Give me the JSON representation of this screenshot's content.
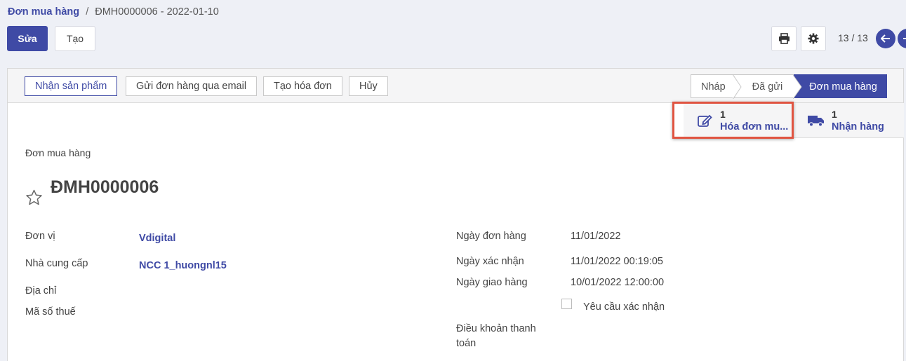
{
  "breadcrumb": {
    "parent": "Đơn mua hàng",
    "separator": "/",
    "current": "ĐMH0000006 - 2022-01-10"
  },
  "toolbar": {
    "edit_label": "Sửa",
    "create_label": "Tạo",
    "print_icon": "print-icon",
    "settings_icon": "gear-icon",
    "pager": "13 / 13"
  },
  "header_buttons": {
    "receive": "Nhận sản phẩm",
    "send_email": "Gửi đơn hàng qua email",
    "create_invoice": "Tạo hóa đơn",
    "cancel": "Hủy"
  },
  "stages": {
    "draft": "Nháp",
    "sent": "Đã gửi",
    "purchase_order": "Đơn mua hàng"
  },
  "smart_buttons": {
    "invoice": {
      "count": "1",
      "label": "Hóa đơn mu..."
    },
    "receipt": {
      "count": "1",
      "label": "Nhận hàng"
    }
  },
  "form": {
    "doc_type": "Đơn mua hàng",
    "name": "ĐMH0000006",
    "left": {
      "unit_label": "Đơn vị",
      "unit_value": "Vdigital",
      "vendor_label": "Nhà cung cấp",
      "vendor_value": "NCC 1_huongnl15",
      "address_label": "Địa chỉ",
      "tax_label": "Mã số thuế"
    },
    "right": {
      "order_date_label": "Ngày đơn hàng",
      "order_date_value": "11/01/2022",
      "confirm_date_label": "Ngày xác nhận",
      "confirm_date_value": "11/01/2022 00:19:05",
      "delivery_date_label": "Ngày giao hàng",
      "delivery_date_value": "10/01/2022 12:00:00",
      "require_confirm_label": "Yêu cầu xác nhận",
      "payment_terms_label_1": "Điều khoản thanh",
      "payment_terms_label_2": "toán"
    }
  },
  "colors": {
    "primary": "#3f4aa5",
    "highlight": "#e05441"
  }
}
